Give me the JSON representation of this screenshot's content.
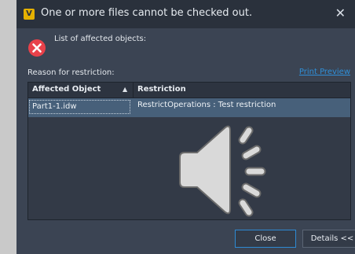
{
  "window": {
    "title": "One or more files cannot be checked out.",
    "close_glyph": "✕",
    "app_icon_glyph": "V"
  },
  "header": {
    "affected_label": "List of affected objects:"
  },
  "reason": {
    "label": "Reason for restriction:",
    "print_preview": "Print Preview"
  },
  "table": {
    "columns": [
      "Affected Object",
      "Restriction"
    ],
    "sort_glyph": "▲",
    "rows": [
      {
        "object": "Part1-1.idw",
        "restriction": "RestrictOperations : Test restriction"
      }
    ]
  },
  "buttons": {
    "close": "Close",
    "details": "Details <<"
  },
  "colors": {
    "background": "#3b4453",
    "titlebar": "#2a313c",
    "accent": "#2e8ad3",
    "error": "#e8414a",
    "selected_row": "#47607a"
  }
}
